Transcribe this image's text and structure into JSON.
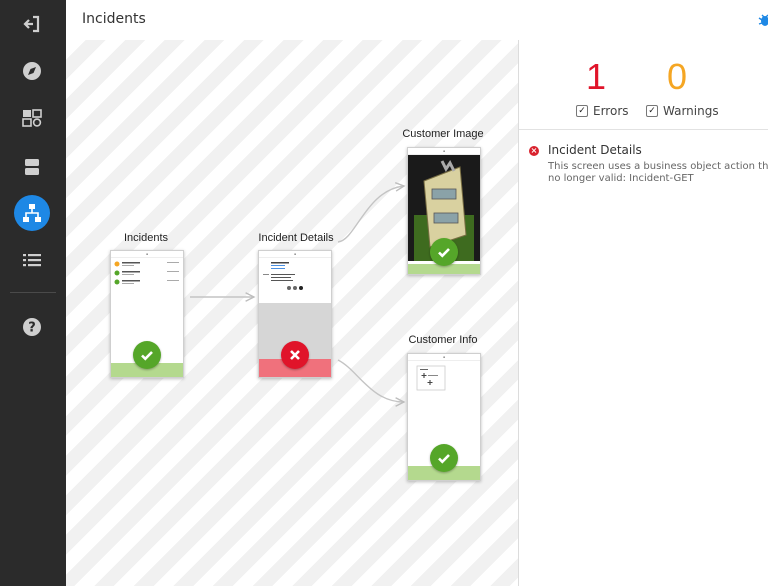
{
  "header": {
    "title": "Incidents"
  },
  "sidebar": {
    "items": [
      {
        "icon": "exit-icon"
      },
      {
        "icon": "compass-icon"
      },
      {
        "icon": "dashboard-icon"
      },
      {
        "icon": "database-icon"
      },
      {
        "icon": "sitemap-icon",
        "active": true
      },
      {
        "icon": "list-icon"
      },
      {
        "icon": "help-icon"
      }
    ]
  },
  "flow": {
    "nodes": [
      {
        "label": "Incidents",
        "status": "ok"
      },
      {
        "label": "Incident Details",
        "status": "error"
      },
      {
        "label": "Customer Image",
        "status": "ok"
      },
      {
        "label": "Customer Info",
        "status": "ok"
      }
    ]
  },
  "summary": {
    "errors_count": "1",
    "warnings_count": "0",
    "errors_label": "Errors",
    "warnings_label": "Warnings",
    "errors_checked": true,
    "warnings_checked": true
  },
  "issue": {
    "title": "Incident Details",
    "description_line1": "This screen uses a business object action that i",
    "description_line2": "no longer valid: Incident-GET"
  },
  "colors": {
    "accent": "#1e88e5",
    "error": "#e0142a",
    "warning": "#f5a623",
    "ok": "#55a629",
    "sidebar": "#2b2b2b"
  }
}
